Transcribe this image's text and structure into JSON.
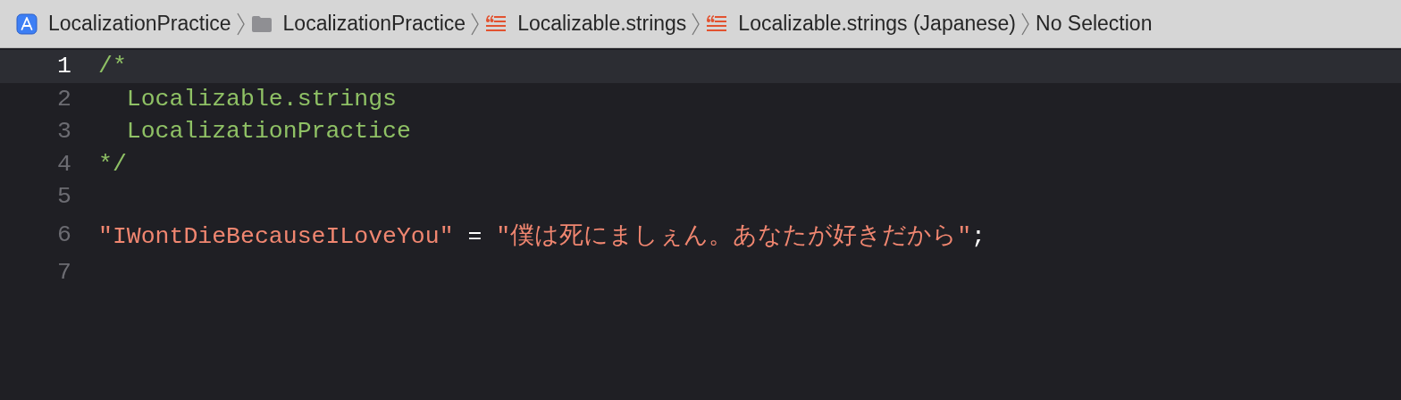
{
  "breadcrumbs": [
    {
      "kind": "project",
      "label": "LocalizationPractice"
    },
    {
      "kind": "folder",
      "label": "LocalizationPractice"
    },
    {
      "kind": "strings",
      "label": "Localizable.strings"
    },
    {
      "kind": "strings",
      "label": "Localizable.strings (Japanese)"
    },
    {
      "kind": "text",
      "label": "No Selection"
    }
  ],
  "editor": {
    "lines": [
      {
        "number": "1",
        "current": true,
        "tokens": [
          {
            "kind": "comment",
            "text": "/*"
          }
        ]
      },
      {
        "number": "2",
        "current": false,
        "tokens": [
          {
            "kind": "comment",
            "text": "  Localizable.strings"
          }
        ]
      },
      {
        "number": "3",
        "current": false,
        "tokens": [
          {
            "kind": "comment",
            "text": "  LocalizationPractice"
          }
        ]
      },
      {
        "number": "4",
        "current": false,
        "tokens": [
          {
            "kind": "comment",
            "text": "*/"
          }
        ]
      },
      {
        "number": "5",
        "current": false
      },
      {
        "number": "6",
        "current": false,
        "tokens": [
          {
            "kind": "string",
            "text": "\"IWontDieBecauseILoveYou\""
          },
          {
            "kind": "plain",
            "text": " = "
          },
          {
            "kind": "string",
            "text": "\"僕は死にましぇん。あなたが好きだから\""
          },
          {
            "kind": "plain",
            "text": ";"
          }
        ]
      },
      {
        "number": "7",
        "current": false
      }
    ]
  }
}
